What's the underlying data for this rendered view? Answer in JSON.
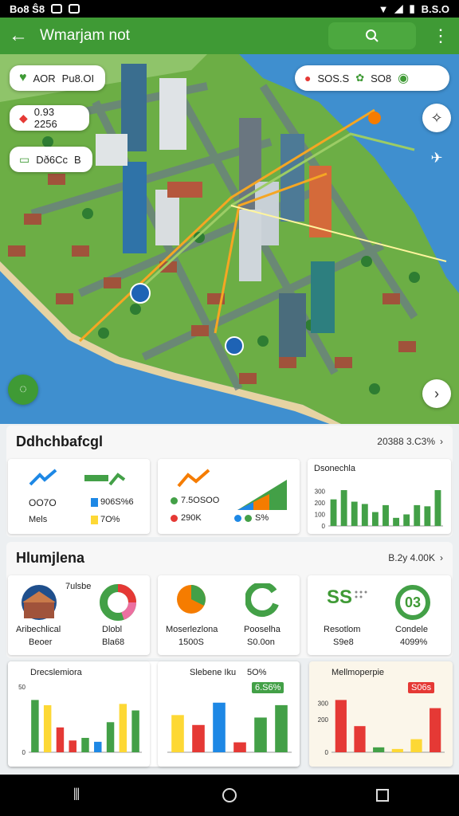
{
  "status_bar": {
    "left_text": "Bo8 Ŝ8",
    "right_text": "B.S.O"
  },
  "app_bar": {
    "title": "Wmarjam not"
  },
  "map": {
    "chips": [
      {
        "text": "AOR",
        "text2": "Pu8.OI"
      },
      {
        "text": "0.93 2256"
      },
      {
        "text": "Dð6Cc",
        "text2": "B"
      },
      {
        "text": "SOS.S",
        "text2": "SO8"
      }
    ]
  },
  "section1": {
    "title": "Ddhchbafcgl",
    "meta": "20388  3.C3%",
    "card1": {
      "big": "OO7O",
      "label": "Mels",
      "legend1": "906S%6",
      "legend2": "7O%"
    },
    "card2": {
      "legend1": "7.5OSOO",
      "legend2": "290K",
      "legend3": "S%"
    },
    "card3": {
      "title": "Dsonechla",
      "chart_data": {
        "type": "bar",
        "title": "Dsonechla",
        "ylim": [
          0,
          400
        ],
        "yticks": [
          "0",
          "100",
          "200",
          "300"
        ],
        "series": [
          {
            "color": "#43a047",
            "values": [
              230,
              310,
              210,
              190,
              120,
              180,
              70,
              100,
              180,
              170,
              310
            ]
          },
          {
            "color": "#e53935",
            "values": [
              0,
              0,
              0,
              0,
              0,
              0,
              60,
              0,
              0,
              0,
              0
            ]
          }
        ]
      }
    }
  },
  "section2": {
    "title": "Hlumjlena",
    "meta": "B.2y  4.00K",
    "card1": {
      "tag": "7ulsbe",
      "l1": "Aribechlical",
      "l2": "Beoer",
      "r1": "Dlobl",
      "r2": "Bla68"
    },
    "card2": {
      "l1": "Moserlezlona",
      "l2": "1500S",
      "r1": "Pooselha",
      "r2": "S0.0on"
    },
    "card3": {
      "big": "SS",
      "l1": "Resotlom",
      "l2": "S9e8",
      "r1": "Condele",
      "r2": "4099%",
      "ring": "03"
    }
  },
  "section3": {
    "card1": {
      "title": "Drecslemiora",
      "chart_data": {
        "type": "bar",
        "title": "Drecslemiora",
        "ylim": [
          0,
          50
        ],
        "yticks": [
          "0",
          "50"
        ],
        "values": [
          {
            "v": 40,
            "c": "#43a047"
          },
          {
            "v": 36,
            "c": "#fdd835"
          },
          {
            "v": 19,
            "c": "#e53935"
          },
          {
            "v": 9,
            "c": "#e53935"
          },
          {
            "v": 11,
            "c": "#43a047"
          },
          {
            "v": 8,
            "c": "#1e88e5"
          },
          {
            "v": 23,
            "c": "#43a047"
          },
          {
            "v": 37,
            "c": "#fdd835"
          },
          {
            "v": 32,
            "c": "#43a047"
          }
        ]
      }
    },
    "card2": {
      "title": "Slebene Iku",
      "badge1": "5O%",
      "badge2": "6.S6%",
      "chart_data": {
        "type": "bar",
        "title": "Slebene Iku",
        "values": [
          {
            "v": 30,
            "c": "#fdd835"
          },
          {
            "v": 22,
            "c": "#e53935"
          },
          {
            "v": 40,
            "c": "#1e88e5"
          },
          {
            "v": 8,
            "c": "#e53935"
          },
          {
            "v": 28,
            "c": "#43a047"
          },
          {
            "v": 38,
            "c": "#43a047"
          }
        ]
      }
    },
    "card3": {
      "title": "Mellmoperpie",
      "badge": "S06s",
      "chart_data": {
        "type": "bar",
        "title": "Mellmoperpie",
        "ylim": [
          0,
          400
        ],
        "yticks": [
          "0",
          "200",
          "300"
        ],
        "values": [
          {
            "v": 320,
            "c": "#e53935"
          },
          {
            "v": 160,
            "c": "#e53935"
          },
          {
            "v": 30,
            "c": "#43a047"
          },
          {
            "v": 20,
            "c": "#fdd835"
          },
          {
            "v": 80,
            "c": "#fdd835"
          },
          {
            "v": 270,
            "c": "#e53935"
          }
        ]
      }
    }
  },
  "colors": {
    "primary": "#3f9a35",
    "accent_orange": "#f57c00",
    "accent_red": "#e53935",
    "accent_yellow": "#fdd835",
    "accent_blue": "#1e88e5"
  }
}
